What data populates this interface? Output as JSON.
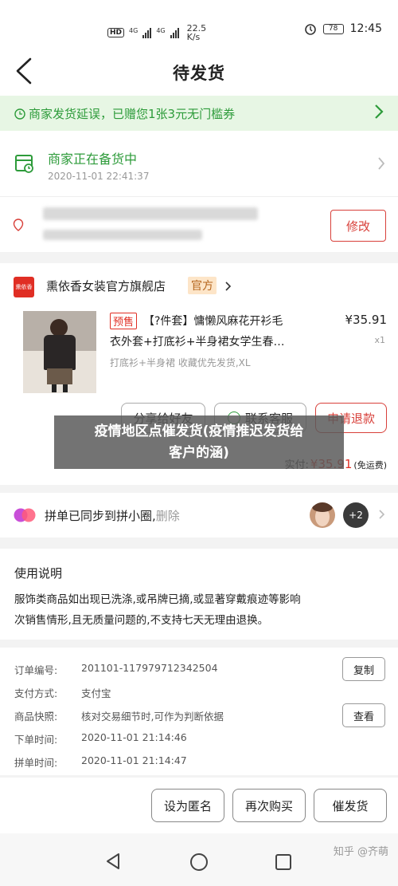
{
  "status_bar": {
    "hd_label": "HD",
    "sim1": "4G",
    "sim2": "4G",
    "speed_value": "22.5",
    "speed_unit": "K/s",
    "battery": "78",
    "time": "12:45"
  },
  "header": {
    "title": "待发货"
  },
  "notice": {
    "text": "商家发货延误，已赠您1张3元无门槛券"
  },
  "shipping": {
    "status": "商家正在备货中",
    "time": "2020-11-01  22:41:37"
  },
  "address": {
    "modify_label": "修改"
  },
  "store": {
    "logo_text": "熏依香",
    "name": "熏依香女装官方旗舰店",
    "badge": "官方"
  },
  "product": {
    "presale_tag": "预售",
    "title_line1": "【?件套】慵懒风麻花开衫毛",
    "title_line2": "衣外套+打底衫+半身裙女学生春…",
    "spec": "打底衫+半身裙  收藏优先发货,XL",
    "price": "¥35.91",
    "qty": "x1"
  },
  "actions": {
    "share": "分享给好友",
    "contact": "联系客服",
    "refund": "申请退款"
  },
  "paid": {
    "label": "实付:",
    "amount": "¥35.91",
    "note": "(免运费)"
  },
  "overlay": {
    "line1": "疫情地区点催发货(疫情推迟发货给",
    "line2": "客户的涵)"
  },
  "pinxiaoquan": {
    "text": "拼单已同步到拼小圈,",
    "delete": "删除",
    "count": "+2"
  },
  "usage": {
    "title": "使用说明",
    "line1": "服饰类商品如出现已洗涤,或吊牌已摘,或显著穿戴痕迹等影响",
    "line2": "次销售情形,且无质量问题的,不支持七天无理由退换。"
  },
  "order_info": {
    "rows": [
      {
        "label": "订单编号:",
        "value": "201101-117979712342504",
        "button": "复制"
      },
      {
        "label": "支付方式:",
        "value": "支付宝",
        "button": ""
      },
      {
        "label": "商品快照:",
        "value": "核对交易细节时,可作为判断依据",
        "button": "查看"
      },
      {
        "label": "下单时间:",
        "value": "2020-11-01  21:14:46",
        "button": ""
      },
      {
        "label": "拼单时间:",
        "value": "2020-11-01  21:14:47",
        "button": ""
      }
    ]
  },
  "bottom_actions": {
    "anon": "设为匿名",
    "rebuy": "再次购买",
    "urge": "催发货"
  },
  "watermark": "知乎 @齐萌",
  "colors": {
    "green": "#2d9b3a",
    "red": "#d8403a",
    "brand_red": "#e02e24"
  }
}
